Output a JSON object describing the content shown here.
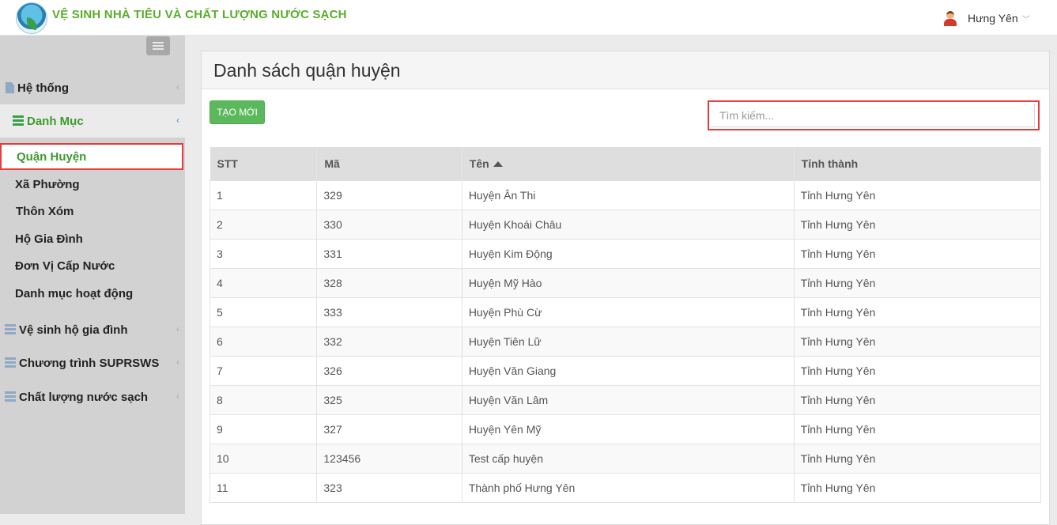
{
  "header": {
    "app_title": "VỆ SINH NHÀ TIÊU VÀ CHẤT LƯỢNG NƯỚC SẠCH",
    "user_name": "Hưng Yên",
    "caret": "﹀"
  },
  "sidebar": {
    "items": [
      {
        "label": "Hệ thống",
        "icon": "file-icon"
      },
      {
        "label": "Danh Mục",
        "icon": "list-icon"
      },
      {
        "label": "Vệ sinh hộ gia đình",
        "icon": "server-icon"
      },
      {
        "label": "Chương trình SUPRSWS",
        "icon": "server-icon"
      },
      {
        "label": "Chất lượng nước sạch",
        "icon": "server-icon"
      }
    ],
    "sub_items": [
      {
        "label": "Quận Huyện",
        "active": true
      },
      {
        "label": "Xã Phường"
      },
      {
        "label": "Thôn Xóm"
      },
      {
        "label": "Hộ Gia Đình"
      },
      {
        "label": "Đơn Vị Cấp Nước"
      },
      {
        "label": "Danh mục hoạt động"
      }
    ],
    "chevron": "‹"
  },
  "main": {
    "title": "Danh sách quận huyện",
    "create_label": "TẠO MỚI",
    "search_placeholder": "Tìm kiếm...",
    "columns": [
      "STT",
      "Mã",
      "Tên",
      "Tỉnh thành"
    ],
    "sort_column": "Tên",
    "rows": [
      [
        "1",
        "329",
        "Huyện Ân Thi",
        "Tỉnh Hưng Yên"
      ],
      [
        "2",
        "330",
        "Huyện Khoái Châu",
        "Tỉnh Hưng Yên"
      ],
      [
        "3",
        "331",
        "Huyện Kim Động",
        "Tỉnh Hưng Yên"
      ],
      [
        "4",
        "328",
        "Huyện Mỹ Hào",
        "Tỉnh Hưng Yên"
      ],
      [
        "5",
        "333",
        "Huyện Phù Cừ",
        "Tỉnh Hưng Yên"
      ],
      [
        "6",
        "332",
        "Huyện Tiên Lữ",
        "Tỉnh Hưng Yên"
      ],
      [
        "7",
        "326",
        "Huyện Văn Giang",
        "Tỉnh Hưng Yên"
      ],
      [
        "8",
        "325",
        "Huyện Văn Lâm",
        "Tỉnh Hưng Yên"
      ],
      [
        "9",
        "327",
        "Huyện Yên Mỹ",
        "Tỉnh Hưng Yên"
      ],
      [
        "10",
        "123456",
        "Test cấp huyện",
        "Tỉnh Hưng Yên"
      ],
      [
        "11",
        "323",
        "Thành phố Hưng Yên",
        "Tỉnh Hưng Yên"
      ]
    ]
  },
  "colors": {
    "brand_green": "#5aac2a",
    "active_green": "#3d9a2e",
    "highlight_red": "#e53d3d",
    "create_button": "#5cb85c"
  }
}
